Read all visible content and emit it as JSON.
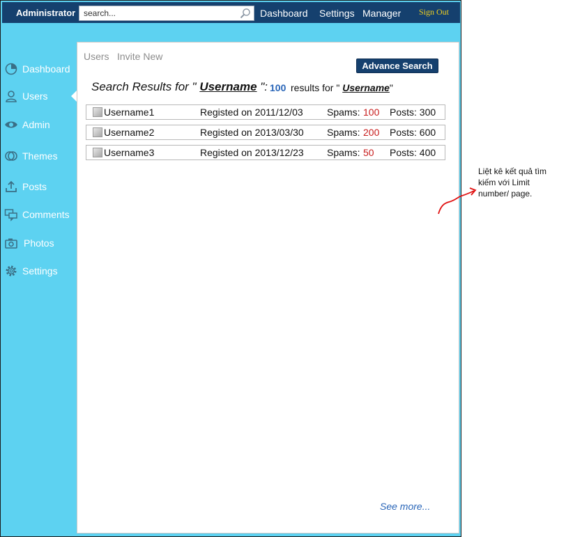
{
  "header": {
    "brand": "Administrator",
    "search": {
      "placeholder": "search...",
      "value": ""
    },
    "nav": [
      "Dashboard",
      "Settings",
      "Manager"
    ],
    "signout": "Sign Out"
  },
  "sidebar": {
    "items": [
      {
        "label": "Dashboard",
        "icon": "pie-chart-icon"
      },
      {
        "label": "Users",
        "icon": "user-icon",
        "active": true
      },
      {
        "label": "Admin",
        "icon": "eye-icon"
      },
      {
        "label": "Themes",
        "icon": "themes-icon"
      },
      {
        "label": "Posts",
        "icon": "upload-icon"
      },
      {
        "label": "Comments",
        "icon": "comments-icon"
      },
      {
        "label": "Photos",
        "icon": "camera-icon"
      },
      {
        "label": "Settings",
        "icon": "gear-icon"
      }
    ]
  },
  "subtabs": [
    "Users",
    "Invite New"
  ],
  "advance_search": "Advance Search",
  "results_header": {
    "prefix": "Search Results for \" ",
    "keyword": "Username",
    "suffix": " \":",
    "count": "100",
    "count_prefix": "results for \" ",
    "count_keyword": "Username",
    "count_suffix": "\""
  },
  "results": [
    {
      "name": "Username1",
      "registered": "Registed on 2011/12/03",
      "spams_label": "Spams:",
      "spams": "100",
      "posts": "Posts: 300"
    },
    {
      "name": "Username2",
      "registered": "Registed on 2013/03/30",
      "spams_label": "Spams:",
      "spams": "200",
      "posts": "Posts: 600"
    },
    {
      "name": "Username3",
      "registered": "Registed on 2013/12/23",
      "spams_label": "Spams:",
      "spams": "50",
      "posts": "Posts: 400"
    }
  ],
  "see_more": "See more...",
  "annotation": "Liệt kê kết quả tìm kiếm với Limit number/ page.",
  "colors": {
    "header_bg": "#15406e",
    "sidebar_bg": "#5dd2f1",
    "link_blue": "#2a66b8",
    "spam_red": "#c81e1e",
    "signout_yellow": "#f0d020"
  }
}
